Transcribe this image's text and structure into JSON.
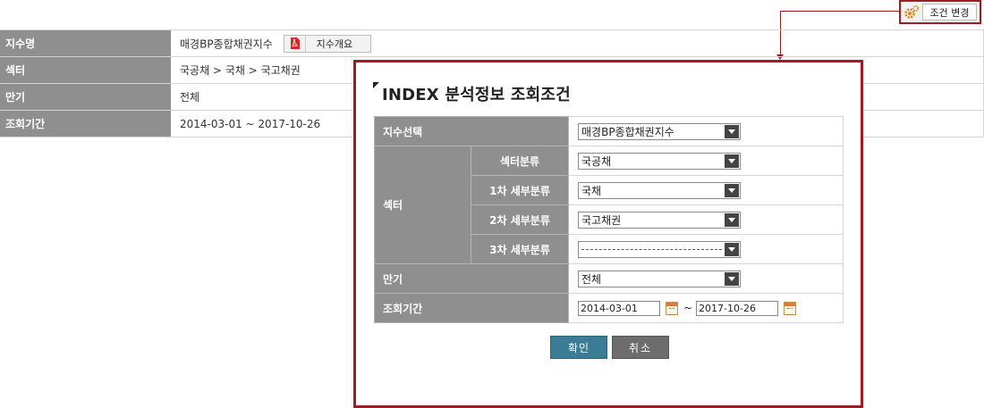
{
  "header": {
    "change_condition_label": "조건 변경",
    "change_condition_icon": "gear-icon"
  },
  "summary": {
    "rows": [
      {
        "label": "지수명",
        "value": "매경BP종합채권지수"
      },
      {
        "label": "섹터",
        "value": "국공채 > 국채 > 국고채권"
      },
      {
        "label": "만기",
        "value": "전체"
      },
      {
        "label": "조회기간",
        "value": "2014-03-01 ~ 2017-10-26"
      }
    ],
    "overview_button_label": "지수개요",
    "overview_button_icon": "pdf-icon"
  },
  "popup": {
    "title": "INDEX 분석정보 조회조건",
    "index_select": {
      "label": "지수선택",
      "value": "매경BP종합채권지수"
    },
    "sector": {
      "label": "섹터",
      "rows": [
        {
          "label": "섹터분류",
          "value": "국공채"
        },
        {
          "label": "1차 세부분류",
          "value": "국채"
        },
        {
          "label": "2차 세부분류",
          "value": "국고채권"
        },
        {
          "label": "3차 세부분류",
          "value": ""
        }
      ]
    },
    "maturity": {
      "label": "만기",
      "value": "전체"
    },
    "period": {
      "label": "조회기간",
      "start": "2014-03-01",
      "separator": "~",
      "end": "2017-10-26"
    },
    "confirm_label": "확인",
    "cancel_label": "취소"
  },
  "colors": {
    "accent_border": "#a01c23",
    "header_cell": "#8f8f8f",
    "confirm_button": "#3c7c95",
    "cancel_button": "#6d6d6d"
  }
}
